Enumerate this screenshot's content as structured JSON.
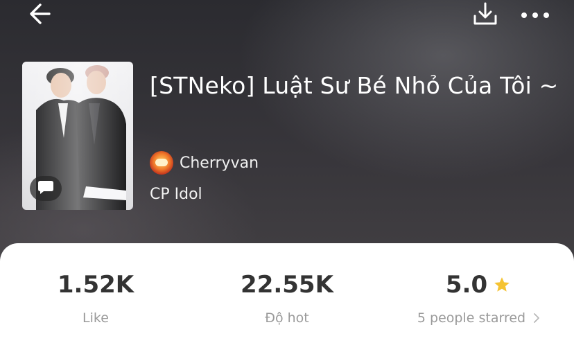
{
  "header": {
    "back_icon": "arrow-left-icon",
    "download_icon": "download-icon",
    "more_icon": "more-horizontal-icon"
  },
  "story": {
    "title": "[STNeko] Luật Sư Bé Nhỏ Của Tôi ~",
    "author": "Cherryvan",
    "category": "CP Idol",
    "cover_badge_icon": "comment-bubble-icon"
  },
  "stats": {
    "likes": {
      "value": "1.52K",
      "label": "Like"
    },
    "hot": {
      "value": "22.55K",
      "label": "Độ hot"
    },
    "rating": {
      "value": "5.0",
      "label": "5 people starred",
      "star_color": "#f5c332"
    }
  },
  "colors": {
    "card_background": "#ffffff",
    "value_text": "#333333",
    "label_text": "#9a9a9a"
  }
}
